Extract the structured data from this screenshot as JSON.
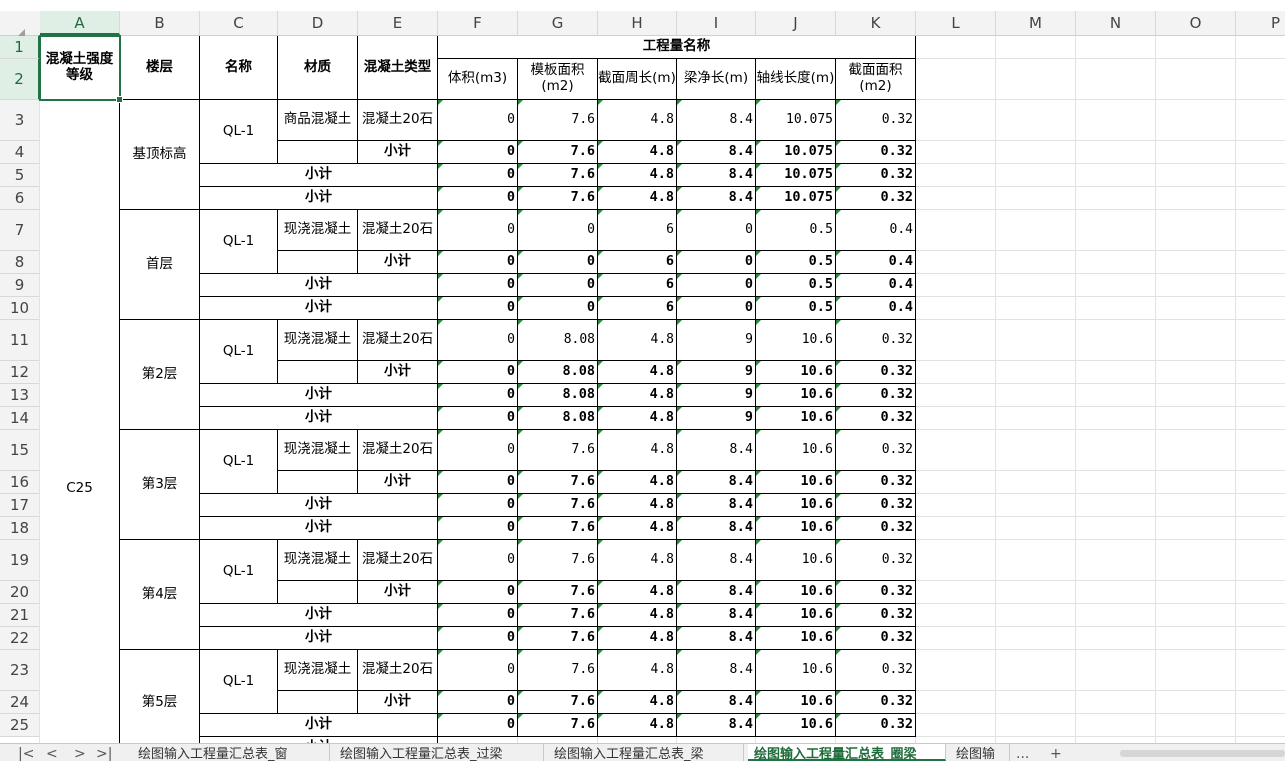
{
  "columns": [
    "A",
    "B",
    "C",
    "D",
    "E",
    "F",
    "G",
    "H",
    "I",
    "J",
    "K",
    "L",
    "M",
    "N",
    "O",
    "P"
  ],
  "selected_column": "A",
  "selected_cell": "A1",
  "rows": [
    "1",
    "2",
    "3",
    "4",
    "5",
    "6",
    "7",
    "8",
    "9",
    "10",
    "11",
    "12",
    "13",
    "14",
    "15",
    "16",
    "17",
    "18",
    "19",
    "20",
    "21",
    "22",
    "23",
    "24",
    "25"
  ],
  "selected_rows": [
    "1",
    "2"
  ],
  "header": {
    "grade": "混凝土强度等级",
    "floor": "楼层",
    "name": "名称",
    "material": "材质",
    "concrete_type": "混凝土类型",
    "quantity_group": "工程量名称",
    "quantity_columns": [
      "体积(m3)",
      "模板面积(m2)",
      "截面周长(m)",
      "梁净长(m)",
      "轴线长度(m)",
      "截面面积(m2)"
    ]
  },
  "grade_value": "C25",
  "subtotal_label": "小计",
  "type_value": "混凝土20石",
  "name_value": "QL-1",
  "floors": [
    {
      "floor": "基顶标高",
      "material": "商品混凝土",
      "values": [
        "0",
        "7.6",
        "4.8",
        "8.4",
        "10.075",
        "0.32"
      ]
    },
    {
      "floor": "首层",
      "material": "现浇混凝土",
      "values": [
        "0",
        "0",
        "6",
        "0",
        "0.5",
        "0.4"
      ]
    },
    {
      "floor": "第2层",
      "material": "现浇混凝土",
      "values": [
        "0",
        "8.08",
        "4.8",
        "9",
        "10.6",
        "0.32"
      ]
    },
    {
      "floor": "第3层",
      "material": "现浇混凝土",
      "values": [
        "0",
        "7.6",
        "4.8",
        "8.4",
        "10.6",
        "0.32"
      ]
    },
    {
      "floor": "第4层",
      "material": "现浇混凝土",
      "values": [
        "0",
        "7.6",
        "4.8",
        "8.4",
        "10.6",
        "0.32"
      ]
    },
    {
      "floor": "第5层",
      "material": "现浇混凝土",
      "values": [
        "0",
        "7.6",
        "4.8",
        "8.4",
        "10.6",
        "0.32"
      ]
    }
  ],
  "sheet_tabs": [
    {
      "label": "绘图输入工程量汇总表_窗",
      "active": false
    },
    {
      "label": "绘图输入工程量汇总表_过梁",
      "active": false
    },
    {
      "label": "绘图输入工程量汇总表_梁",
      "active": false
    },
    {
      "label": "绘图输入工程量汇总表_圈梁",
      "active": true
    },
    {
      "label": "绘图输",
      "active": false
    }
  ],
  "nav_buttons": [
    "|<",
    "<",
    ">",
    ">|"
  ],
  "tab_extra": {
    "more": "...",
    "add": "+"
  },
  "colors": {
    "accent": "#217346",
    "header_bg": "#f3f3f3",
    "marker": "#2e8b3d"
  }
}
